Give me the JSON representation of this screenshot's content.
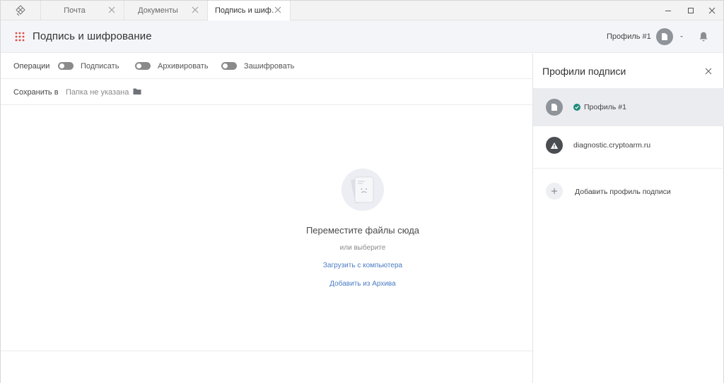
{
  "tabs": [
    {
      "label": "Почта",
      "active": false
    },
    {
      "label": "Документы",
      "active": false
    },
    {
      "label": "Подпись и шиф…",
      "active": true
    }
  ],
  "header": {
    "title": "Подпись и шифрование",
    "profile_label": "Профиль #1",
    "apps_icon": "grid-dots-icon",
    "accent": "#e5473d"
  },
  "operations": {
    "label": "Операции",
    "toggles": [
      {
        "label": "Подписать",
        "on": false
      },
      {
        "label": "Архивировать",
        "on": false
      },
      {
        "label": "Зашифровать",
        "on": false
      }
    ]
  },
  "save_to": {
    "label": "Сохранить в",
    "value": "Папка не указана"
  },
  "drop_zone": {
    "title": "Переместите файлы сюда",
    "subtitle": "или выберите",
    "link_upload": "Загрузить с компьютера",
    "link_archive": "Добавить из Архива",
    "link_color": "#4b7cc4"
  },
  "panel": {
    "title": "Профили подписи",
    "profiles": [
      {
        "label": "Профиль #1",
        "selected": true,
        "status": "check-icon",
        "status_color": "#1f8a7b"
      },
      {
        "label": "diagnostic.cryptoarm.ru",
        "selected": false,
        "status": "warning-icon"
      }
    ],
    "add_label": "Добавить профиль подписи"
  }
}
